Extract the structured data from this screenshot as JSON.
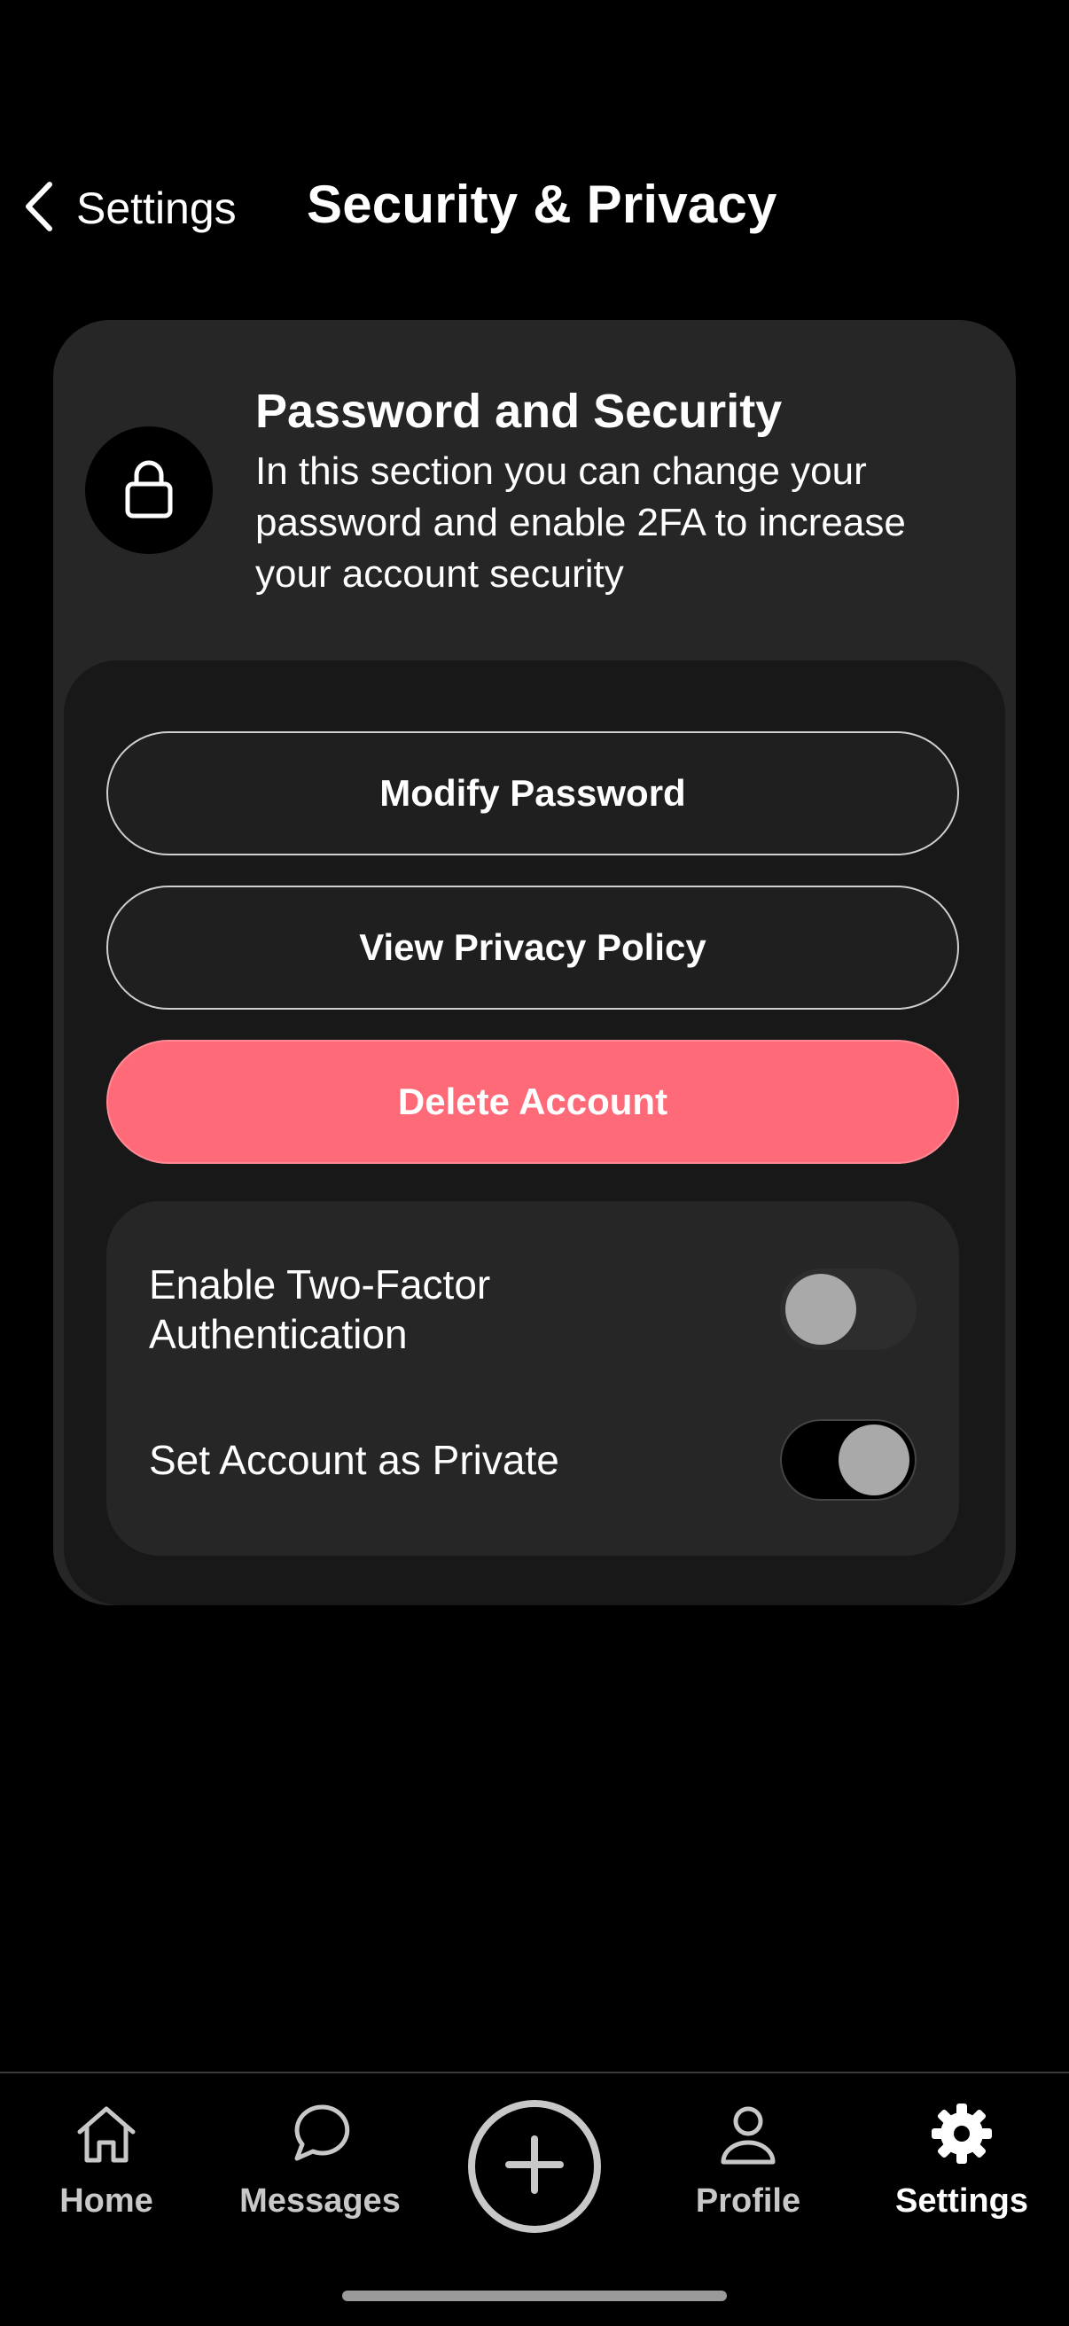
{
  "header": {
    "back_label": "Settings",
    "title": "Security & Privacy"
  },
  "card": {
    "title": "Password and Security",
    "description": "In this section you can change your password and enable 2FA to increase your account security",
    "icon": "lock-icon"
  },
  "actions": {
    "modify_password": "Modify Password",
    "view_privacy_policy": "View Privacy Policy",
    "delete_account": "Delete Account"
  },
  "toggles": [
    {
      "label": "Enable Two-Factor Authentication",
      "on": false
    },
    {
      "label": "Set Account as Private",
      "on": true
    }
  ],
  "nav": {
    "home": "Home",
    "messages": "Messages",
    "profile": "Profile",
    "settings": "Settings",
    "active": "settings"
  },
  "colors": {
    "background": "#000000",
    "card": "#262626",
    "danger": "#ff6a78"
  }
}
